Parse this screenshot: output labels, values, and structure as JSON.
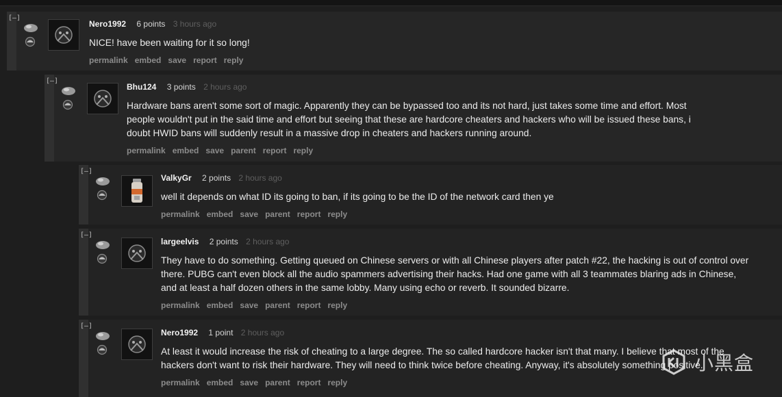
{
  "comments": [
    {
      "author": "Nero1992",
      "points": "6 points",
      "time": "3 hours ago",
      "collapse": "[–]",
      "avatar": "wolf-avatar-icon",
      "body": "NICE! have been waiting for it so long!",
      "actions": [
        "permalink",
        "embed",
        "save",
        "report",
        "reply"
      ]
    },
    {
      "author": "Bhu124",
      "points": "3 points",
      "time": "2 hours ago",
      "collapse": "[–]",
      "avatar": "wolf-avatar-icon",
      "body": "Hardware bans aren't some sort of magic. Apparently they can be bypassed too and its not hard, just takes some time and effort. Most people wouldn't put in the said time and effort but seeing that these are hardcore cheaters and hackers who will be issued these bans, i doubt HWID bans will suddenly result in a massive drop in cheaters and hackers running around.",
      "actions": [
        "permalink",
        "embed",
        "save",
        "parent",
        "report",
        "reply"
      ]
    },
    {
      "author": "ValkyGr",
      "points": "2 points",
      "time": "2 hours ago",
      "collapse": "[–]",
      "avatar": "bottle-avatar-icon",
      "body": "well it depends on what ID its going to ban, if its going to be the ID of the network card then ye",
      "actions": [
        "permalink",
        "embed",
        "save",
        "parent",
        "report",
        "reply"
      ]
    },
    {
      "author": "largeelvis",
      "points": "2 points",
      "time": "2 hours ago",
      "collapse": "[–]",
      "avatar": "wolf-avatar-icon",
      "body": "They have to do something. Getting queued on Chinese servers or with all Chinese players after patch #22, the hacking is out of control over there. PUBG can't even block all the audio spammers advertising their hacks. Had one game with all 3 teammates blaring ads in Chinese, and at least a half dozen others in the same lobby. Many using echo or reverb. It sounded bizarre.",
      "actions": [
        "permalink",
        "embed",
        "save",
        "parent",
        "report",
        "reply"
      ]
    },
    {
      "author": "Nero1992",
      "points": "1 point",
      "time": "2 hours ago",
      "collapse": "[–]",
      "avatar": "wolf-avatar-icon",
      "body": "At least it would increase the risk of cheating to a large degree. The so called hardcore hacker isn't that many. I believe that most of the hackers don't want to risk their hardware. They will need to think twice before cheating. Anyway, it's absolutely something positive.",
      "actions": [
        "permalink",
        "embed",
        "save",
        "parent",
        "report",
        "reply"
      ]
    }
  ],
  "watermark": {
    "text": "小黑盒",
    "logo": "xiaoheihe-logo-icon"
  }
}
